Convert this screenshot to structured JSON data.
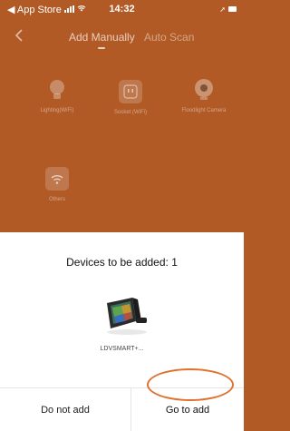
{
  "status_bar": {
    "back_app": "◀ App Store",
    "time": "14:32"
  },
  "nav": {
    "back_icon": "chevron-left-icon",
    "tab_manual": "Add Manually",
    "tab_scan": "Auto Scan"
  },
  "categories": [
    {
      "label": "Lighting(WiFi)",
      "icon": "bulb-icon"
    },
    {
      "label": "Socket (WiFi)",
      "icon": "socket-icon"
    },
    {
      "label": "Floodlight Camera",
      "icon": "camera-icon"
    },
    {
      "label": "Others",
      "icon": "wifi-icon"
    }
  ],
  "sheet": {
    "title": "Devices to be added: 1",
    "device_name": "LDVSMART+...",
    "cancel_label": "Do not add",
    "confirm_label": "Go to add"
  },
  "colors": {
    "background": "#b15a26",
    "highlight": "#e0702c"
  }
}
